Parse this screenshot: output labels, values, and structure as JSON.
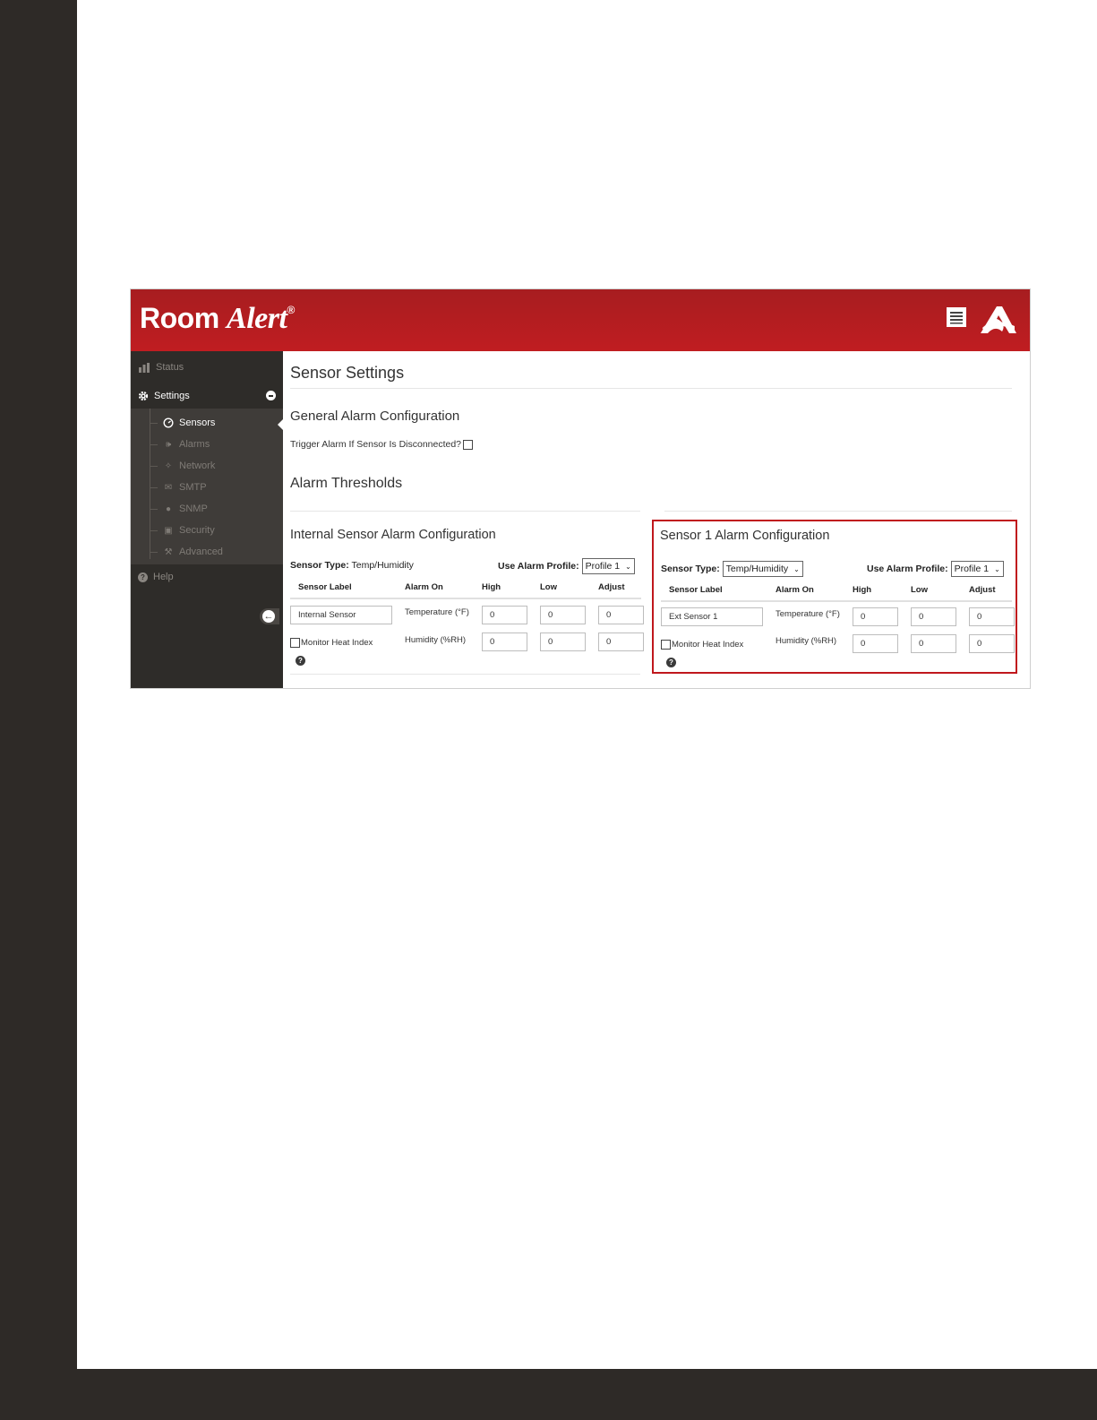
{
  "app": {
    "brand_main": "Room",
    "brand_italic": "Alert",
    "brand_reg": "®",
    "colors": {
      "header_red": "#b71c1f",
      "sidebar": "#2e2c29",
      "highlight_border": "#c0181d"
    }
  },
  "header": {
    "icons": [
      "list-icon",
      "room-alert-logo-icon"
    ]
  },
  "sidebar": {
    "status": {
      "label": "Status",
      "icon": "bar-chart-icon"
    },
    "settings": {
      "label": "Settings",
      "icon": "gear-icon"
    },
    "sub_items": [
      {
        "label": "Sensors",
        "icon": "gauge-icon",
        "active": true
      },
      {
        "label": "Alarms",
        "icon": "megaphone-icon"
      },
      {
        "label": "Network",
        "icon": "network-icon"
      },
      {
        "label": "SMTP",
        "icon": "envelope-icon"
      },
      {
        "label": "SNMP",
        "icon": "snmp-icon"
      },
      {
        "label": "Security",
        "icon": "lock-icon"
      },
      {
        "label": "Advanced",
        "icon": "wrench-icon"
      }
    ],
    "help": {
      "label": "Help",
      "icon": "help-icon"
    }
  },
  "main": {
    "page_title": "Sensor Settings",
    "general_title": "General Alarm Configuration",
    "trigger_label": "Trigger Alarm If Sensor Is Disconnected?",
    "thresholds_title": "Alarm Thresholds",
    "internal": {
      "title": "Internal Sensor Alarm Configuration",
      "sensor_type_label": "Sensor Type:",
      "sensor_type_value": "Temp/Humidity",
      "profile_label": "Use Alarm Profile:",
      "profile_value": "Profile 1",
      "headers": [
        "Sensor Label",
        "Alarm On",
        "High",
        "Low",
        "Adjust"
      ],
      "sensor_label_value": "Internal Sensor",
      "temp_label": "Temperature (°F)",
      "humidity_label": "Humidity (%RH)",
      "temp_values": [
        "0",
        "0",
        "0"
      ],
      "humidity_values": [
        "0",
        "0",
        "0"
      ],
      "heat_index_label": "Monitor Heat Index"
    },
    "sensor1": {
      "title": "Sensor 1 Alarm Configuration",
      "sensor_type_label": "Sensor Type:",
      "sensor_type_value": "Temp/Humidity",
      "profile_label": "Use Alarm Profile:",
      "profile_value": "Profile 1",
      "headers": [
        "Sensor Label",
        "Alarm On",
        "High",
        "Low",
        "Adjust"
      ],
      "sensor_label_value": "Ext Sensor 1",
      "temp_label": "Temperature (°F)",
      "humidity_label": "Humidity (%RH)",
      "temp_values": [
        "0",
        "0",
        "0"
      ],
      "humidity_values": [
        "0",
        "0",
        "0"
      ],
      "heat_index_label": "Monitor Heat Index"
    }
  }
}
